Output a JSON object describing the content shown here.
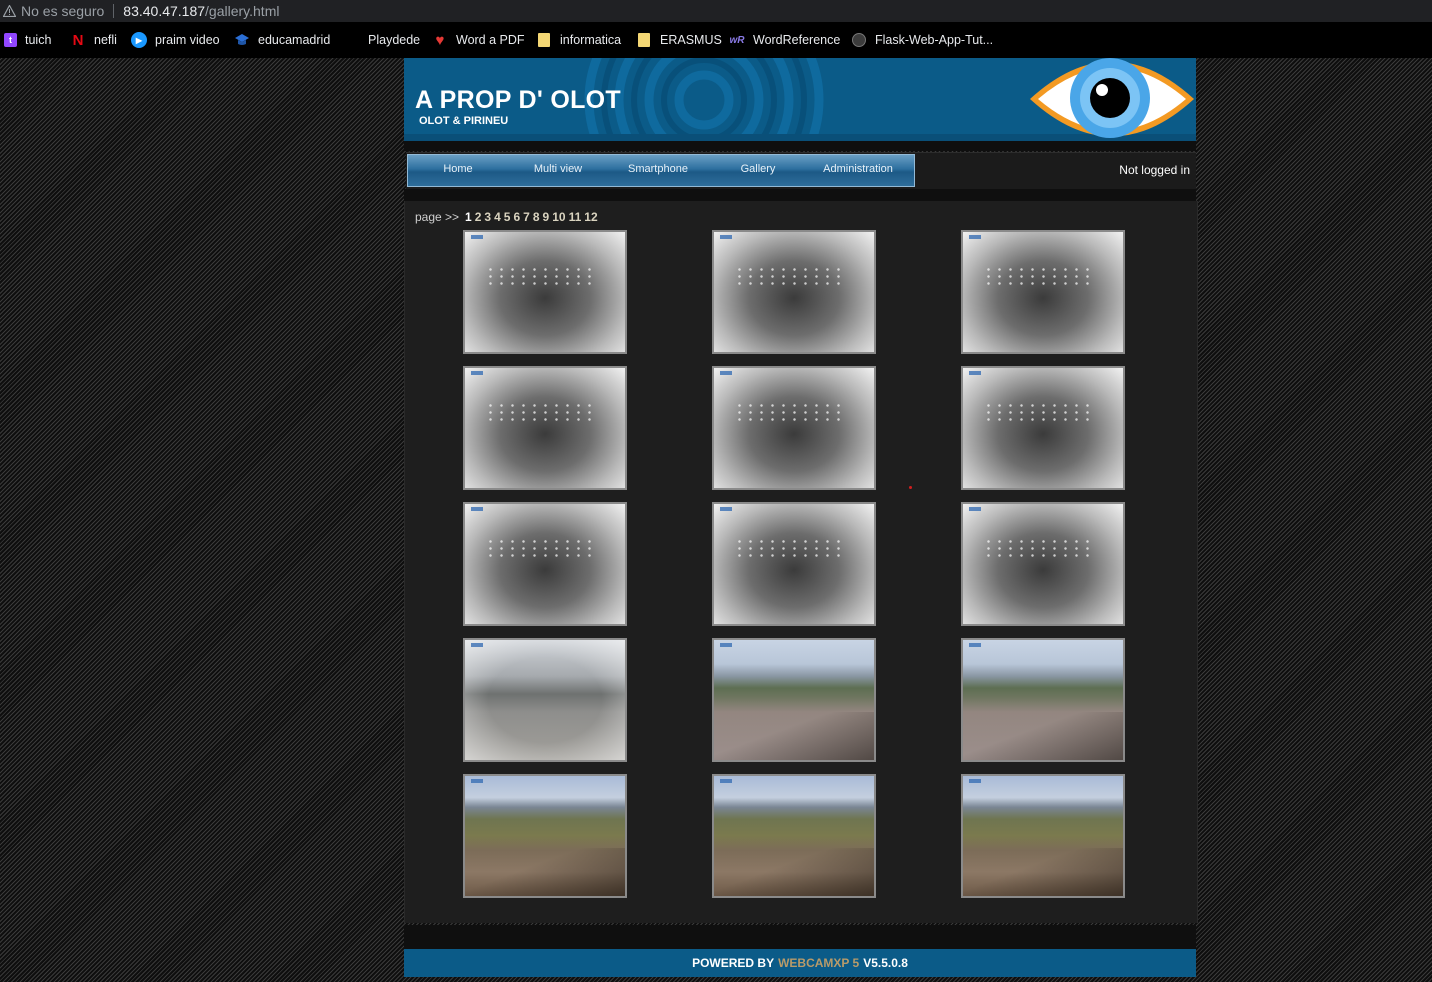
{
  "browser": {
    "security_label": "No es seguro",
    "url_host": "83.40.47.187",
    "url_path": "/gallery.html"
  },
  "bookmarks": [
    {
      "label": "tuich",
      "icon": "twitch-icon"
    },
    {
      "label": "nefli",
      "icon": "netflix-icon"
    },
    {
      "label": "praim video",
      "icon": "prime-video-icon"
    },
    {
      "label": "educamadrid",
      "icon": "educamadrid-icon"
    },
    {
      "label": "Playdede",
      "icon": "playdede-icon"
    },
    {
      "label": "Word a PDF",
      "icon": "heart-icon"
    },
    {
      "label": "informatica",
      "icon": "folder-icon"
    },
    {
      "label": "ERASMUS",
      "icon": "folder-icon"
    },
    {
      "label": "WordReference",
      "icon": "wordreference-icon"
    },
    {
      "label": "Flask-Web-App-Tut...",
      "icon": "github-icon"
    }
  ],
  "header": {
    "title": "A PROP D' OLOT",
    "subtitle": "OLOT & PIRINEU"
  },
  "nav": {
    "items": [
      "Home",
      "Multi view",
      "Smartphone",
      "Gallery",
      "Administration"
    ],
    "login_status": "Not logged in"
  },
  "pagination": {
    "label": "page >>",
    "pages": [
      "1",
      "2",
      "3",
      "4",
      "5",
      "6",
      "7",
      "8",
      "9",
      "10",
      "11",
      "12"
    ],
    "current": "1"
  },
  "gallery": {
    "thumbnails": [
      {
        "scene": "night"
      },
      {
        "scene": "night"
      },
      {
        "scene": "night"
      },
      {
        "scene": "night"
      },
      {
        "scene": "night"
      },
      {
        "scene": "night"
      },
      {
        "scene": "night"
      },
      {
        "scene": "night"
      },
      {
        "scene": "night"
      },
      {
        "scene": "faded"
      },
      {
        "scene": "day1"
      },
      {
        "scene": "day1"
      },
      {
        "scene": "day2"
      },
      {
        "scene": "day2"
      },
      {
        "scene": "day2"
      }
    ]
  },
  "footer": {
    "prefix": "POWERED BY",
    "brand": "WEBCAMXP 5",
    "version": "V5.5.0.8"
  },
  "colors": {
    "header_blue": "#0b5b88",
    "brand_gold": "#b89b6a"
  }
}
